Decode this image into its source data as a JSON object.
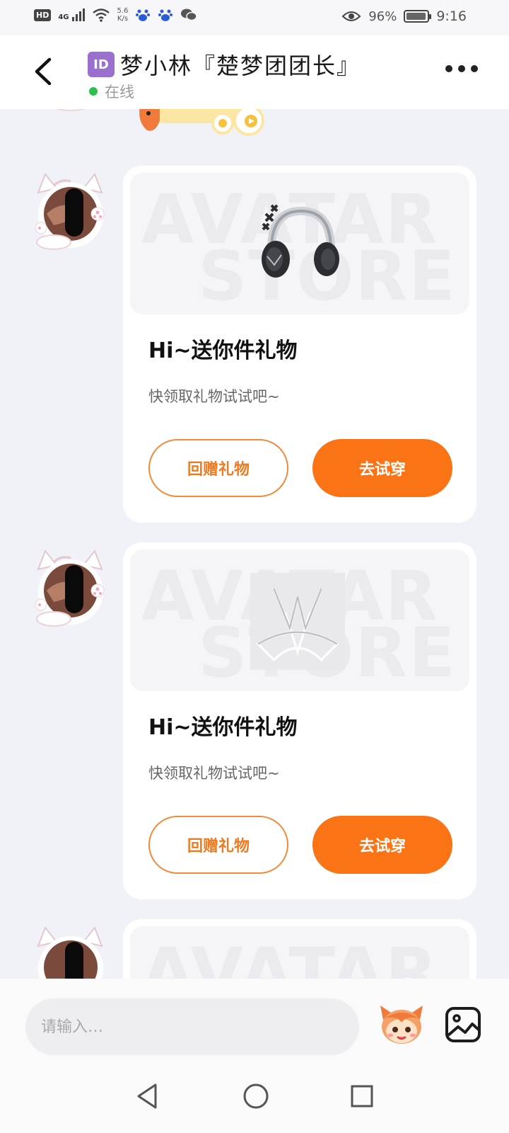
{
  "status_bar": {
    "hd": "HD",
    "network": "4G",
    "speed_value": "5.6",
    "speed_unit": "K/s",
    "battery_percent": "96%",
    "battery_level": 0.96,
    "time": "9:16"
  },
  "header": {
    "id_badge": "ID",
    "title": "梦小林『楚梦团团长』",
    "status": "在线",
    "status_color": "#2ac14f"
  },
  "cards": [
    {
      "title": "Hi~送你件礼物",
      "subtitle": "快领取礼物试试吧~",
      "return_gift_label": "回赠礼物",
      "try_on_label": "去试穿",
      "gift_icon": "headphones-icon"
    },
    {
      "title": "Hi~送你件礼物",
      "subtitle": "快领取礼物试试吧~",
      "return_gift_label": "回赠礼物",
      "try_on_label": "去试穿",
      "gift_icon": "crown-wings-icon"
    }
  ],
  "banner_watermark": [
    "AVATAR",
    "STORE"
  ],
  "input": {
    "placeholder": "请输入…"
  },
  "colors": {
    "accent": "#fa7315",
    "accent_outline": "#f18a3a",
    "background": "#f1f2f7",
    "card": "#ffffff"
  },
  "nav_icons": [
    "back-triangle-icon",
    "home-circle-icon",
    "recent-square-icon"
  ]
}
